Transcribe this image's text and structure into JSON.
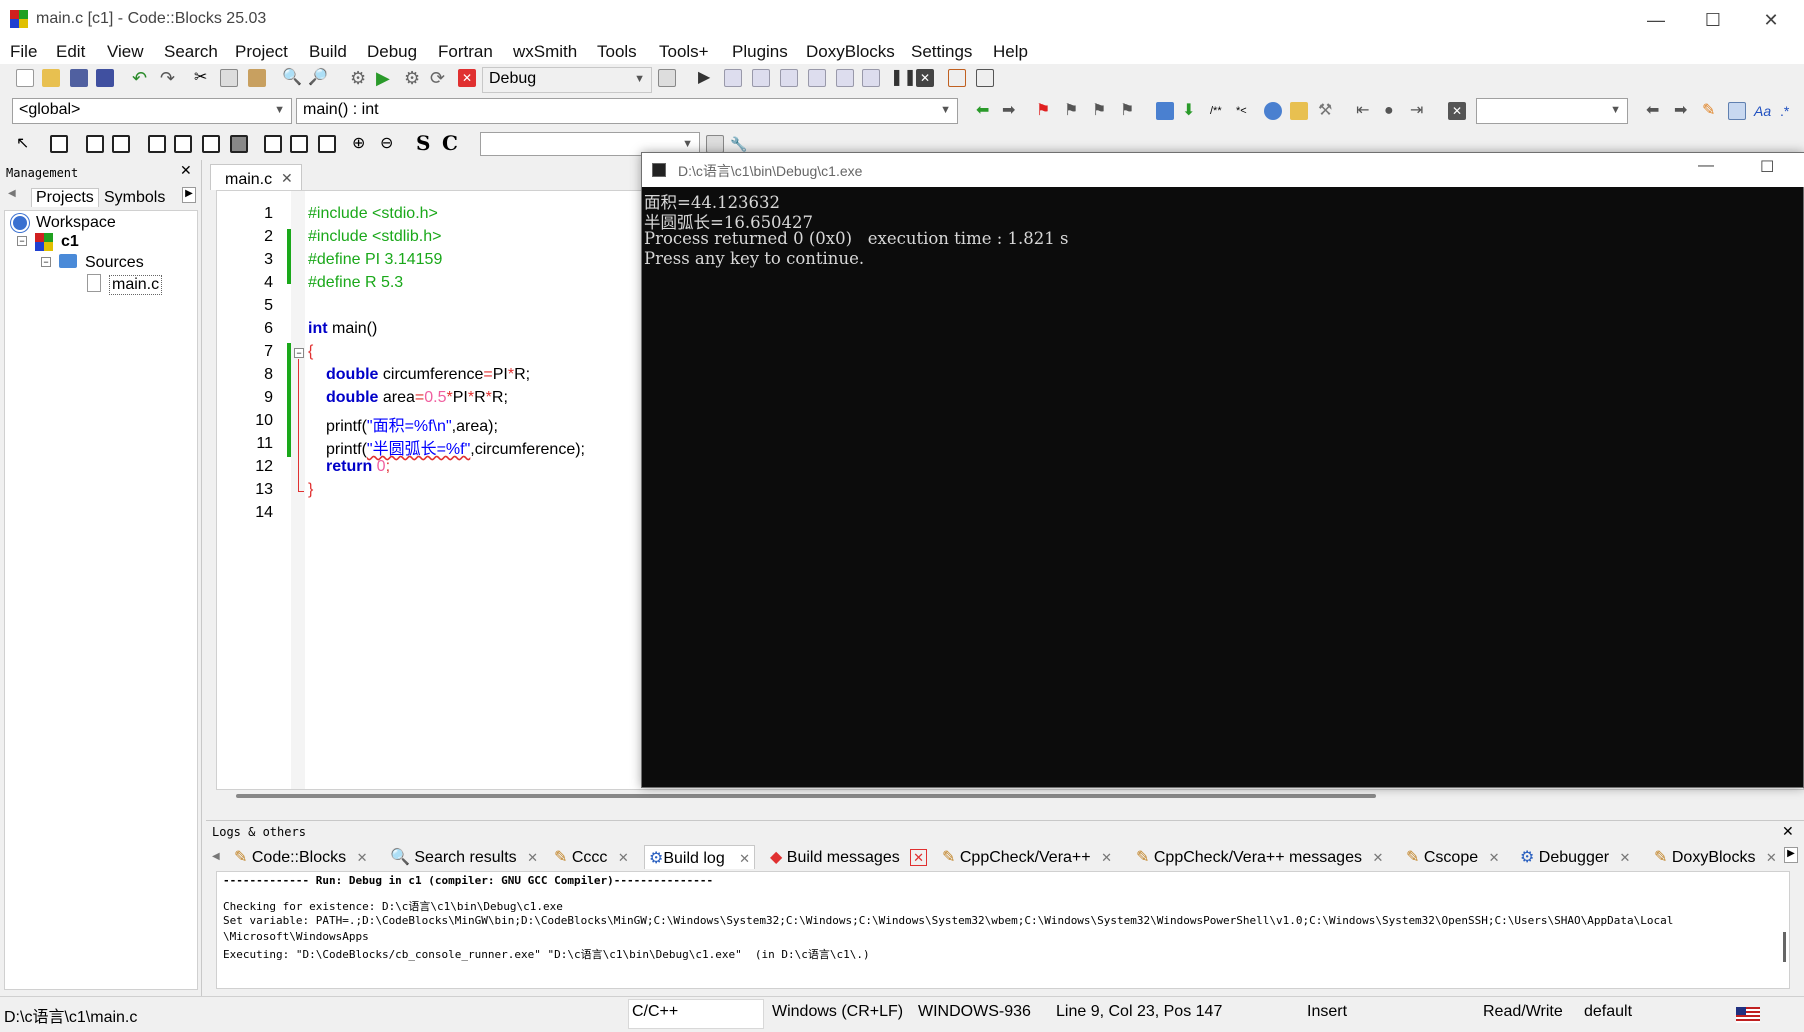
{
  "window": {
    "title": "main.c [c1] - Code::Blocks 25.03"
  },
  "menu": [
    "File",
    "Edit",
    "View",
    "Search",
    "Project",
    "Build",
    "Debug",
    "Fortran",
    "wxSmith",
    "Tools",
    "Tools+",
    "Plugins",
    "DoxyBlocks",
    "Settings",
    "Help"
  ],
  "toolbar": {
    "build_target": "Debug"
  },
  "codecompletion": {
    "scope": "<global>",
    "function": "main() : int"
  },
  "management": {
    "title": "Management",
    "tabs": [
      "Projects",
      "Symbols"
    ],
    "tree": {
      "workspace": "Workspace",
      "project": "c1",
      "folder": "Sources",
      "file": "main.c"
    }
  },
  "editor": {
    "tab": "main.c",
    "lines": [
      "1",
      "2",
      "3",
      "4",
      "5",
      "6",
      "7",
      "8",
      "9",
      "10",
      "11",
      "12",
      "13",
      "14"
    ]
  },
  "code": {
    "l1": "#include <stdio.h>",
    "l2": "#include <stdlib.h>",
    "l3": "#define PI 3.14159",
    "l4": "#define R 5.3",
    "l6_kw": "int",
    "l6_rest": " main()",
    "l7": "{",
    "l8_kw": "double",
    "l8_a": " circumference",
    "l8_b": "=",
    "l8_c": "PI",
    "l8_d": "*",
    "l8_e": "R;",
    "l9_kw": "double",
    "l9_a": " area",
    "l9_b": "=",
    "l9_c": "0.5",
    "l9_d": "*",
    "l9_e": "PI",
    "l9_f": "*",
    "l9_g": "R",
    "l9_h": "*",
    "l9_i": "R;",
    "l10_a": "printf(",
    "l10_s": "\"面积=%f\\n\"",
    "l10_b": ",area);",
    "l11_a": "printf(",
    "l11_s": "\"半圆弧长=%f\"",
    "l11_b": ",circumference);",
    "l12_kw": "return",
    "l12_n": " 0",
    "l12_e": ";",
    "l13": "}"
  },
  "console": {
    "title": "D:\\c语言\\c1\\bin\\Debug\\c1.exe",
    "lines": [
      "面积=44.123632",
      "半圆弧长=16.650427",
      "Process returned 0 (0x0)   execution time : 1.821 s",
      "Press any key to continue."
    ]
  },
  "logs": {
    "title": "Logs & others",
    "tabs": [
      "Code::Blocks",
      "Search results",
      "Cccc",
      "Build log",
      "Build messages",
      "CppCheck/Vera++",
      "CppCheck/Vera++ messages",
      "Cscope",
      "Debugger",
      "DoxyBlocks"
    ],
    "lines": [
      "------------- Run: Debug in c1 (compiler: GNU GCC Compiler)---------------",
      "",
      "Checking for existence: D:\\c语言\\c1\\bin\\Debug\\c1.exe",
      "Set variable: PATH=.;D:\\CodeBlocks\\MinGW\\bin;D:\\CodeBlocks\\MinGW;C:\\Windows\\System32;C:\\Windows;C:\\Windows\\System32\\wbem;C:\\Windows\\System32\\WindowsPowerShell\\v1.0;C:\\Windows\\System32\\OpenSSH;C:\\Users\\SHAO\\AppData\\Local",
      "\\Microsoft\\WindowsApps",
      "Executing: \"D:\\CodeBlocks/cb_console_runner.exe\" \"D:\\c语言\\c1\\bin\\Debug\\c1.exe\"  (in D:\\c语言\\c1\\.)"
    ]
  },
  "statusbar": {
    "path": "D:\\c语言\\c1\\main.c",
    "lang": "C/C++",
    "eol": "Windows (CR+LF)",
    "encoding": "WINDOWS-936",
    "position": "Line 9, Col 23, Pos 147",
    "mode": "Insert",
    "access": "Read/Write",
    "profile": "default"
  },
  "colors": {
    "editor_bg": "#ffffff",
    "console_bg": "#0c0c0c",
    "accent": "#1aa81a"
  }
}
